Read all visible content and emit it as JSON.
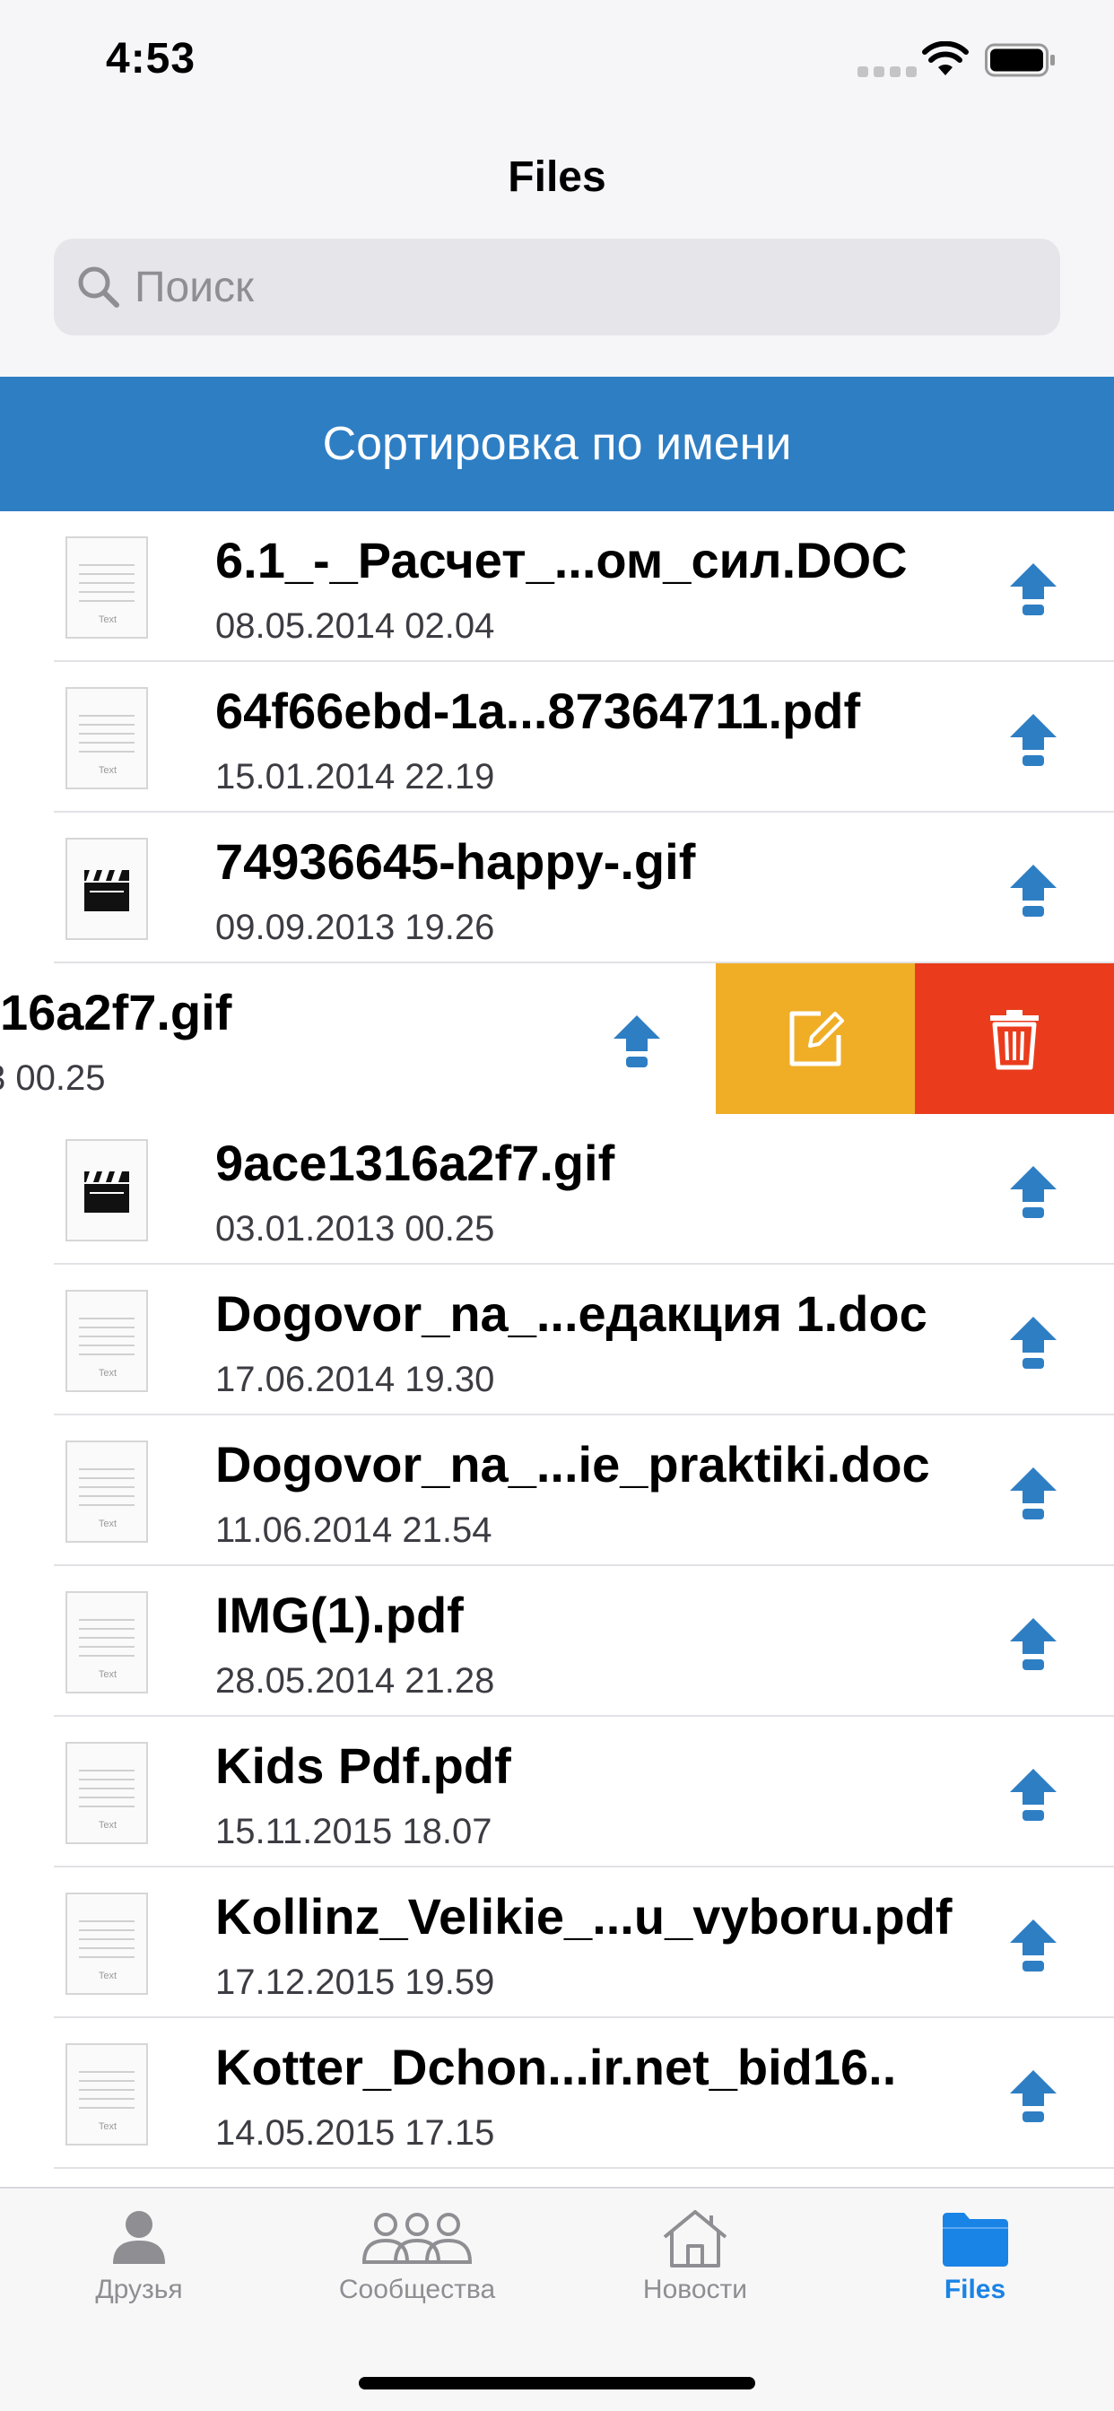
{
  "status": {
    "time": "4:53"
  },
  "nav": {
    "title": "Files"
  },
  "search": {
    "placeholder": "Поиск"
  },
  "sort": {
    "label": "Сортировка по имени"
  },
  "files": [
    {
      "name": "6.1_-_Расчет_...ом_сил.DOC",
      "date": "08.05.2014 02.04",
      "icon": "text-document-icon"
    },
    {
      "name": "64f66ebd-1a...87364711.pdf",
      "date": "15.01.2014 22.19",
      "icon": "text-document-icon"
    },
    {
      "name": "74936645-happy-.gif",
      "date": "09.09.2013 19.26",
      "icon": "video-clapper-icon"
    },
    {
      "name": "9ace1316a2f7.gif",
      "date": "03.01.2013 00.25",
      "icon": "video-clapper-icon"
    },
    {
      "name": "Dogovor_na_...едакция 1.doc",
      "date": "17.06.2014 19.30",
      "icon": "text-document-icon"
    },
    {
      "name": "Dogovor_na_...ie_praktiki.doc",
      "date": "11.06.2014 21.54",
      "icon": "text-document-icon"
    },
    {
      "name": "IMG(1).pdf",
      "date": "28.05.2014 21.28",
      "icon": "text-document-icon"
    },
    {
      "name": "Kids Pdf.pdf",
      "date": "15.11.2015 18.07",
      "icon": "text-document-icon"
    },
    {
      "name": "Kollinz_Velikie_...u_vyboru.pdf",
      "date": "17.12.2015 19.59",
      "icon": "text-document-icon"
    },
    {
      "name": "Kotter_Dchon...ir.net_bid16..",
      "date": "14.05.2015 17.15",
      "icon": "text-document-icon"
    }
  ],
  "swiped": {
    "name": "16a2f7.gif",
    "date": "3 00.25"
  },
  "thumb_text": "Text",
  "tabs": [
    {
      "label": "Друзья",
      "icon": "person-icon"
    },
    {
      "label": "Сообщества",
      "icon": "group-icon"
    },
    {
      "label": "Новости",
      "icon": "house-icon"
    },
    {
      "label": "Files",
      "icon": "folder-icon",
      "active": true
    }
  ],
  "colors": {
    "accent": "#2e7ec4",
    "edit": "#f0ae27",
    "delete": "#ea3c1d",
    "tab_active": "#1a83e6"
  }
}
